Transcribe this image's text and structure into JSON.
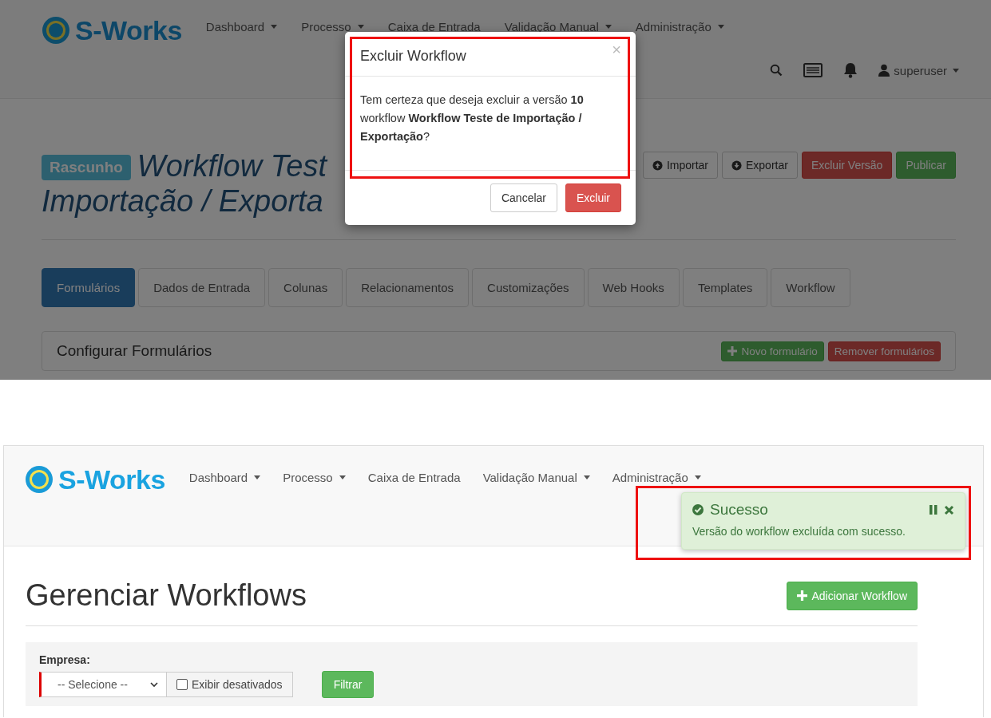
{
  "delete_dialog_screen": {
    "navbar": {
      "brand": "S-Works",
      "menu": [
        {
          "label": "Dashboard",
          "dropdown": true
        },
        {
          "label": "Processo",
          "dropdown": true
        },
        {
          "label": "Caixa de Entrada",
          "dropdown": false
        },
        {
          "label": "Validação Manual",
          "dropdown": true
        },
        {
          "label": "Administração",
          "dropdown": true
        }
      ],
      "user": "superuser"
    },
    "header": {
      "status_badge": "Rascunho",
      "title_lines": [
        "Workflow Test",
        "Importação / Exporta"
      ],
      "actions": [
        {
          "label": "Importar",
          "kind": "default"
        },
        {
          "label": "Exportar",
          "kind": "default"
        },
        {
          "label": "Excluir Versão",
          "kind": "danger"
        },
        {
          "label": "Publicar",
          "kind": "success"
        }
      ]
    },
    "tabs": [
      {
        "label": "Formulários",
        "selected": true
      },
      {
        "label": "Dados de Entrada",
        "selected": false
      },
      {
        "label": "Colunas",
        "selected": false
      },
      {
        "label": "Relacionamentos",
        "selected": false
      },
      {
        "label": "Customizações",
        "selected": false
      },
      {
        "label": "Web Hooks",
        "selected": false
      },
      {
        "label": "Templates",
        "selected": false
      },
      {
        "label": "Workflow",
        "selected": false
      }
    ],
    "panel": {
      "title": "Configurar Formulários",
      "buttons": [
        {
          "label": "Novo formulário",
          "kind": "success"
        },
        {
          "label": "Remover formulários",
          "kind": "danger"
        }
      ]
    },
    "modal": {
      "title": "Excluir Workflow",
      "close": "×",
      "message": "Tem certeza que deseja excluir a versão **10** workflow **Workflow Teste de Importação / Exportação**?",
      "buttons": [
        {
          "label": "Cancelar",
          "kind": "default"
        },
        {
          "label": "Excluir",
          "kind": "danger"
        }
      ]
    }
  },
  "success_screen": {
    "navbar": {
      "brand": "S-Works",
      "menu": [
        {
          "label": "Dashboard",
          "dropdown": true
        },
        {
          "label": "Processo",
          "dropdown": true
        },
        {
          "label": "Caixa de Entrada",
          "dropdown": false
        },
        {
          "label": "Validação Manual",
          "dropdown": true
        },
        {
          "label": "Administração",
          "dropdown": true
        }
      ]
    },
    "toast": {
      "title": "Sucesso",
      "message": "Versão do workflow excluída com sucesso."
    },
    "page_title": "Gerenciar Workflows",
    "add_button": {
      "label": "Adicionar Workflow"
    },
    "filter": {
      "label": "Empresa:",
      "select_value": "-- Selecione --",
      "checkbox": {
        "label": "Exibir desativados",
        "checked": false
      },
      "button": "Filtrar"
    }
  }
}
